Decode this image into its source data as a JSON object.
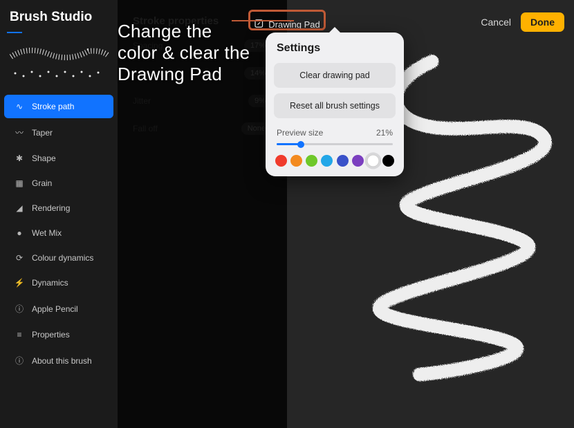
{
  "app_title": "Brush Studio",
  "annotation": "Change the color & clear the Drawing Pad",
  "top": {
    "cancel": "Cancel",
    "done": "Done",
    "drawing_pad": "Drawing Pad"
  },
  "sidebar": {
    "items": [
      {
        "label": "Stroke path",
        "icon": "∿",
        "active": true
      },
      {
        "label": "Taper",
        "icon": "〰",
        "active": false
      },
      {
        "label": "Shape",
        "icon": "✱",
        "active": false
      },
      {
        "label": "Grain",
        "icon": "▦",
        "active": false
      },
      {
        "label": "Rendering",
        "icon": "◢",
        "active": false
      },
      {
        "label": "Wet Mix",
        "icon": "●",
        "active": false
      },
      {
        "label": "Colour dynamics",
        "icon": "⟳",
        "active": false
      },
      {
        "label": "Dynamics",
        "icon": "⚡",
        "active": false
      },
      {
        "label": "Apple Pencil",
        "icon": "ⓘ",
        "active": false
      },
      {
        "label": "Properties",
        "icon": "≡",
        "active": false
      },
      {
        "label": "About this brush",
        "icon": "ⓘ",
        "active": false
      }
    ]
  },
  "properties": {
    "title": "Stroke properties",
    "rows": [
      {
        "label": "Spacing",
        "value": "17%"
      },
      {
        "label": "StreamLine",
        "value": "14%"
      },
      {
        "label": "Jitter",
        "value": "9%"
      },
      {
        "label": "Fall off",
        "value": "None"
      }
    ]
  },
  "popover": {
    "title": "Settings",
    "clear_btn": "Clear drawing pad",
    "reset_btn": "Reset all brush settings",
    "preview_label": "Preview size",
    "preview_value": "21%",
    "preview_pct": 21,
    "swatches": [
      {
        "name": "red",
        "hex": "#f03b2c"
      },
      {
        "name": "orange",
        "hex": "#f38a1f"
      },
      {
        "name": "green",
        "hex": "#6fc82a"
      },
      {
        "name": "cyan",
        "hex": "#23a7e8"
      },
      {
        "name": "blue",
        "hex": "#3a52c9"
      },
      {
        "name": "purple",
        "hex": "#7b3fbf"
      },
      {
        "name": "white",
        "hex": "#ffffff",
        "selected": true
      },
      {
        "name": "black",
        "hex": "#000000"
      }
    ]
  }
}
